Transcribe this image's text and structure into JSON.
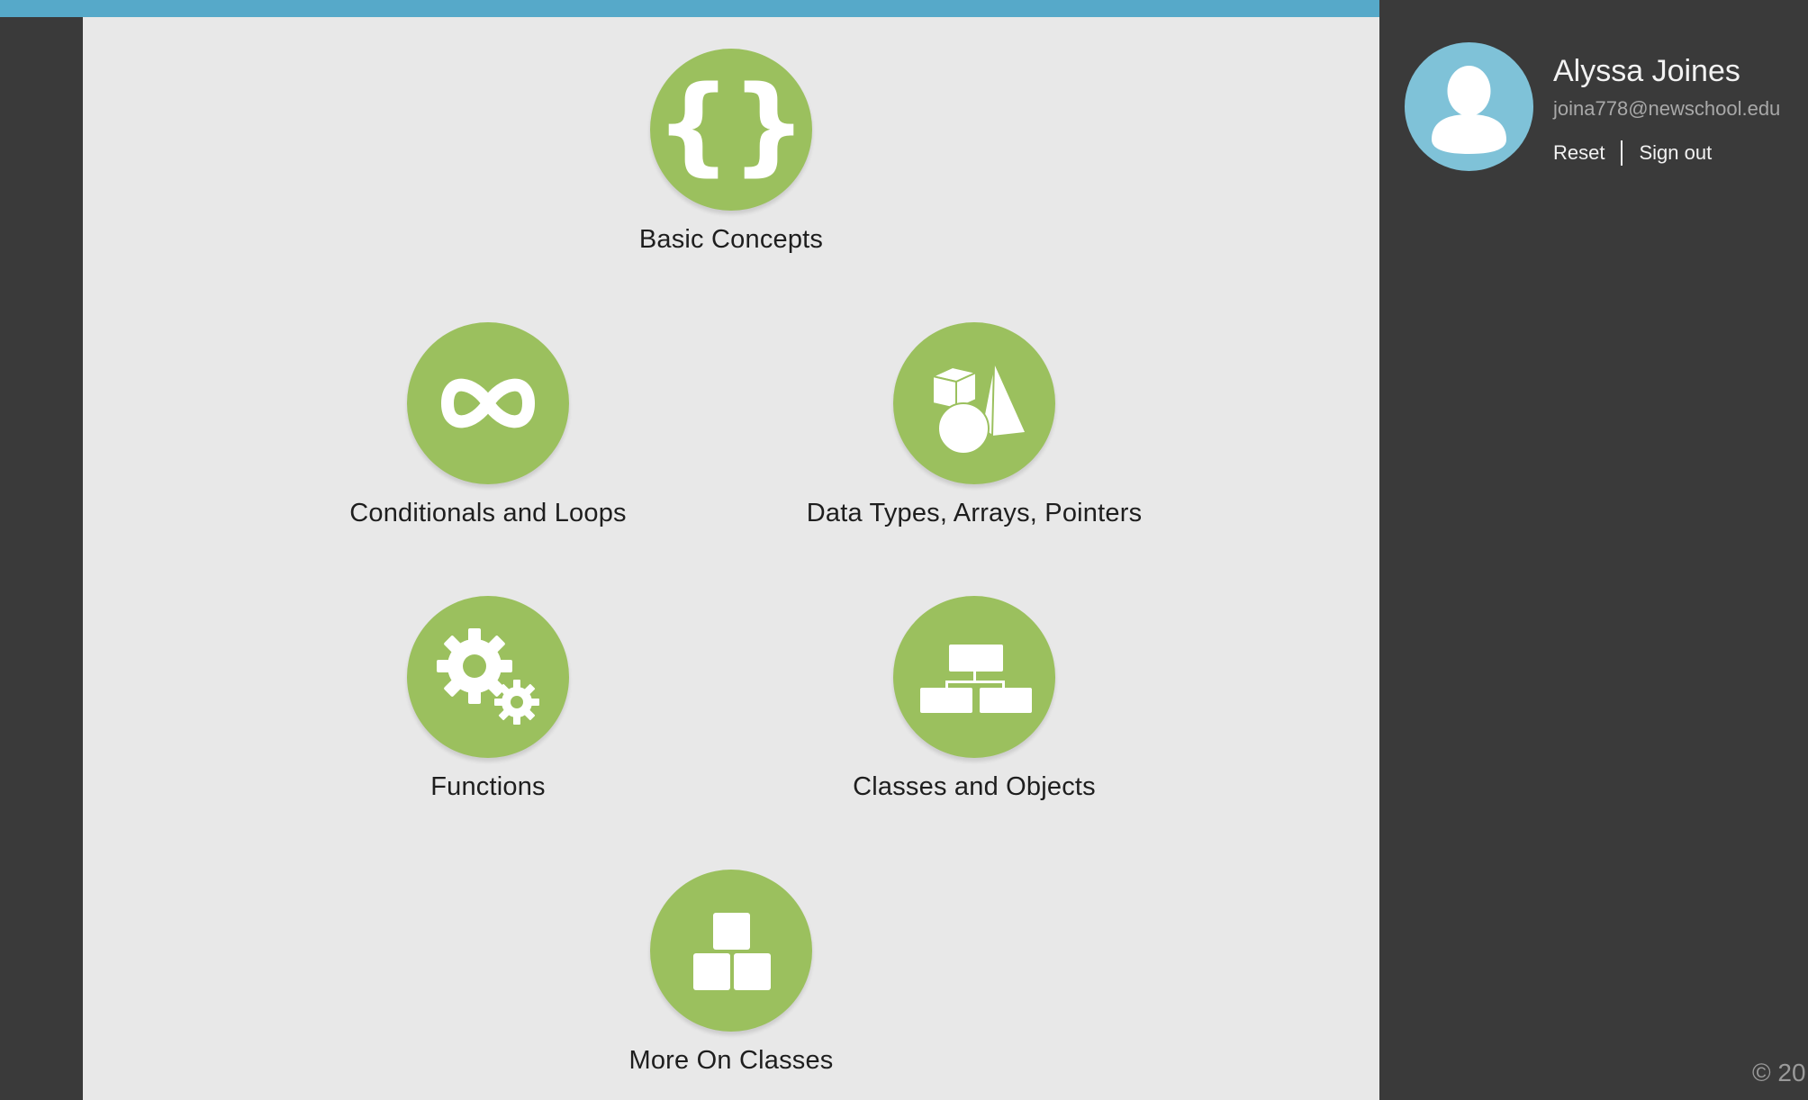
{
  "lessons": [
    {
      "label": "Basic Concepts",
      "icon": "curly-braces-icon"
    },
    {
      "label": "Conditionals and Loops",
      "icon": "infinity-icon"
    },
    {
      "label": "Data Types, Arrays, Pointers",
      "icon": "shapes-icon"
    },
    {
      "label": "Functions",
      "icon": "gears-icon"
    },
    {
      "label": "Classes and Objects",
      "icon": "hierarchy-icon"
    },
    {
      "label": "More On Classes",
      "icon": "blocks-icon"
    }
  ],
  "user": {
    "name": "Alyssa Joines",
    "email": "joina778@newschool.edu",
    "reset_label": "Reset",
    "signout_label": "Sign out",
    "avatar_icon": "user-avatar-icon"
  },
  "footer": {
    "copyright": "© 20"
  },
  "colors": {
    "top_bar": "#56a9c9",
    "lesson_circle": "#9bc05e",
    "main_background": "#e8e8e8",
    "sidebar_background": "#3a3a3a",
    "avatar_background": "#7fc2d8"
  }
}
